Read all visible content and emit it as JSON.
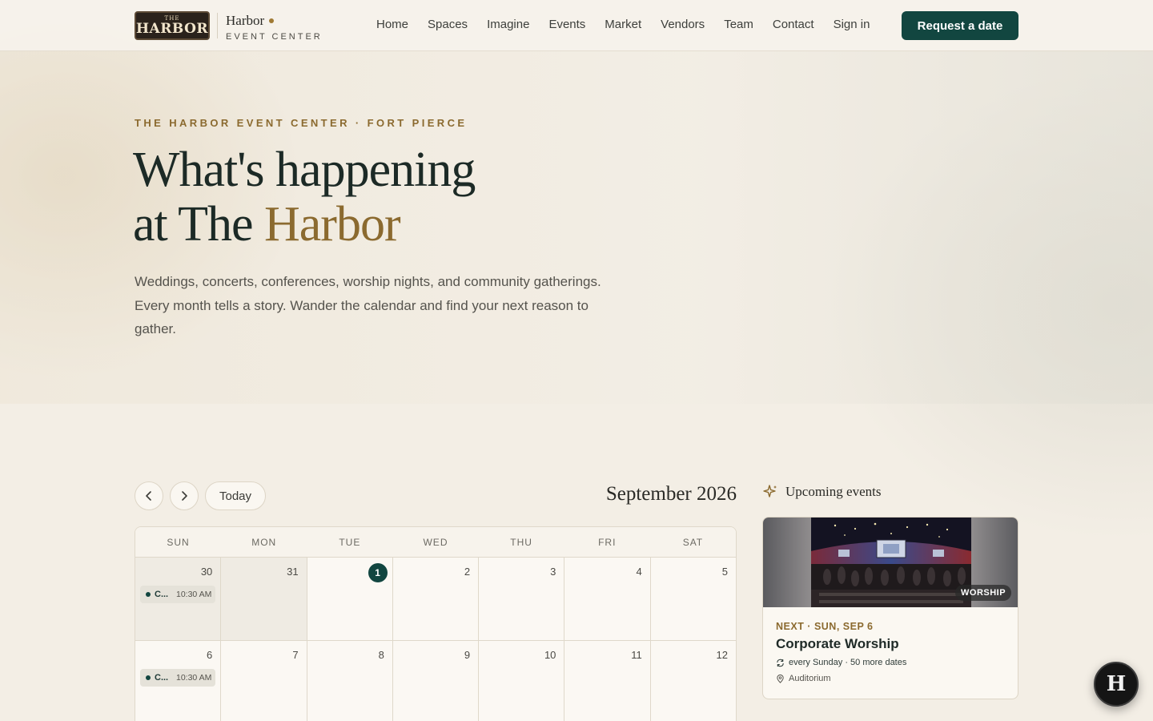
{
  "nav": {
    "logo_small": "THE",
    "logo_big": "HARBOR",
    "brand_name": "Harbor",
    "brand_sub": "EVENT CENTER",
    "links": [
      "Home",
      "Spaces",
      "Imagine",
      "Events",
      "Market",
      "Vendors",
      "Team",
      "Contact",
      "Sign in"
    ],
    "cta": "Request a date"
  },
  "hero": {
    "eyebrow": "THE HARBOR EVENT CENTER · FORT PIERCE",
    "title_line1": "What's happening",
    "title_line2_prefix": "at The ",
    "title_line2_accent": "Harbor",
    "description": "Weddings, concerts, conferences, worship nights, and community gatherings. Every month tells a story. Wander the calendar and find your next reason to gather."
  },
  "calendar": {
    "today_label": "Today",
    "month_title": "September 2026",
    "days_of_week": [
      "SUN",
      "MON",
      "TUE",
      "WED",
      "THU",
      "FRI",
      "SAT"
    ],
    "weeks": [
      [
        {
          "num": "30",
          "muted": true,
          "event": {
            "title": "C...",
            "time": "10:30 AM"
          }
        },
        {
          "num": "31",
          "muted": true
        },
        {
          "num": "1",
          "today": true
        },
        {
          "num": "2"
        },
        {
          "num": "3"
        },
        {
          "num": "4"
        },
        {
          "num": "5"
        }
      ],
      [
        {
          "num": "6",
          "event": {
            "title": "C...",
            "time": "10:30 AM"
          }
        },
        {
          "num": "7"
        },
        {
          "num": "8"
        },
        {
          "num": "9"
        },
        {
          "num": "10"
        },
        {
          "num": "11"
        },
        {
          "num": "12"
        }
      ]
    ]
  },
  "upcoming": {
    "title": "Upcoming events",
    "card": {
      "tag": "WORSHIP",
      "kicker": "NEXT · SUN, SEP 6",
      "title": "Corporate Worship",
      "recurrence": "every Sunday · 50 more dates",
      "location": "Auditorium"
    }
  },
  "fab": {
    "letter": "H"
  },
  "colors": {
    "brand_dark": "#124640",
    "accent_gold": "#8b6a2f",
    "background": "#f3eee5"
  },
  "icons": {
    "prev": "chevron-left-icon",
    "next": "chevron-right-icon",
    "sparkle": "sparkle-icon",
    "repeat": "repeat-icon",
    "location": "location-pin-icon"
  }
}
